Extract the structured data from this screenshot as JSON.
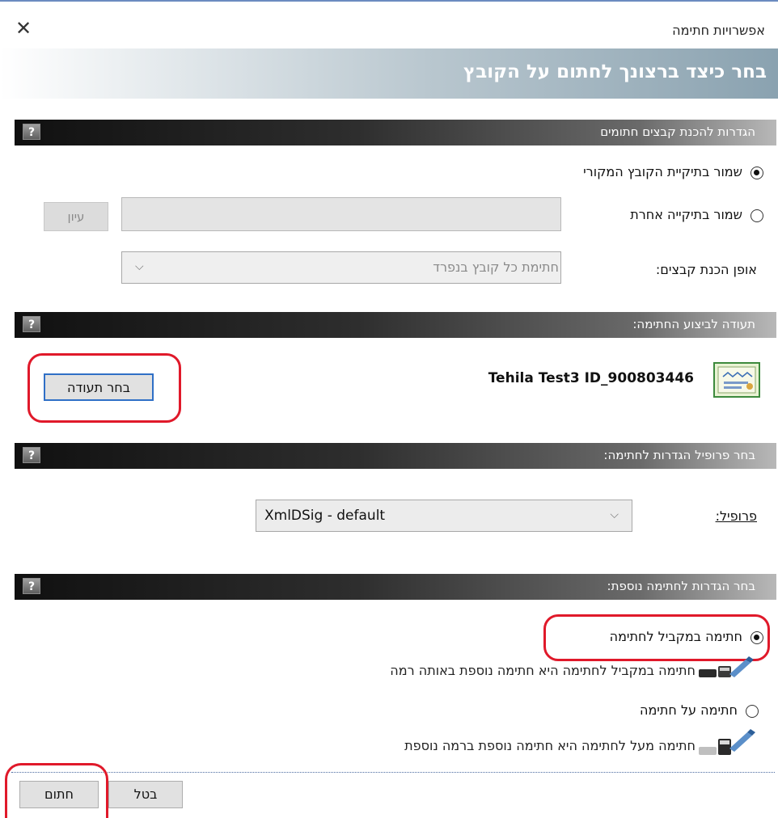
{
  "window": {
    "title": "אפשרויות חתימה",
    "close_glyph": "✕"
  },
  "banner": {
    "title": "בחר כיצד ברצונך לחתום על הקובץ"
  },
  "sections": {
    "prepare": {
      "title": "הגדרות להכנת קבצים חתומים",
      "save_original": "שמור בתיקיית הקובץ המקורי",
      "save_other": "שמור בתיקייה אחרת",
      "folder_path_value": "",
      "browse": "עיון",
      "file_prep_label": "אופן הכנת קבצים:",
      "file_prep_value": "חתימת כל קובץ בנפרד"
    },
    "certificate": {
      "title": "תעודה לביצוע החתימה:",
      "cert_name": "Tehila Test3 ID_900803446",
      "choose_button": "בחר תעודה"
    },
    "profile": {
      "title": "בחר פרופיל הגדרות לחתימה:",
      "label": "פרופיל:",
      "value": "XmlDSig - default"
    },
    "additional": {
      "title": "בחר הגדרות לחתימה נוספת:",
      "parallel_label": "חתימה במקביל לחתימה",
      "parallel_desc": "חתימה במקביל לחתימה היא חתימה נוספת באותה רמה",
      "counter_label": "חתימה על חתימה",
      "counter_desc": "חתימה מעל לחתימה היא חתימה נוספת ברמה נוספת"
    }
  },
  "help_glyph": "?",
  "chevron_glyph": "⌵",
  "footer": {
    "sign": "חתום",
    "cancel": "בטל"
  },
  "options": {
    "save_location": "original",
    "additional_signature": "parallel"
  },
  "colors": {
    "highlight": "#e0192a",
    "banner": "#8aa2b0",
    "section_bar": "#2e2e2e"
  }
}
